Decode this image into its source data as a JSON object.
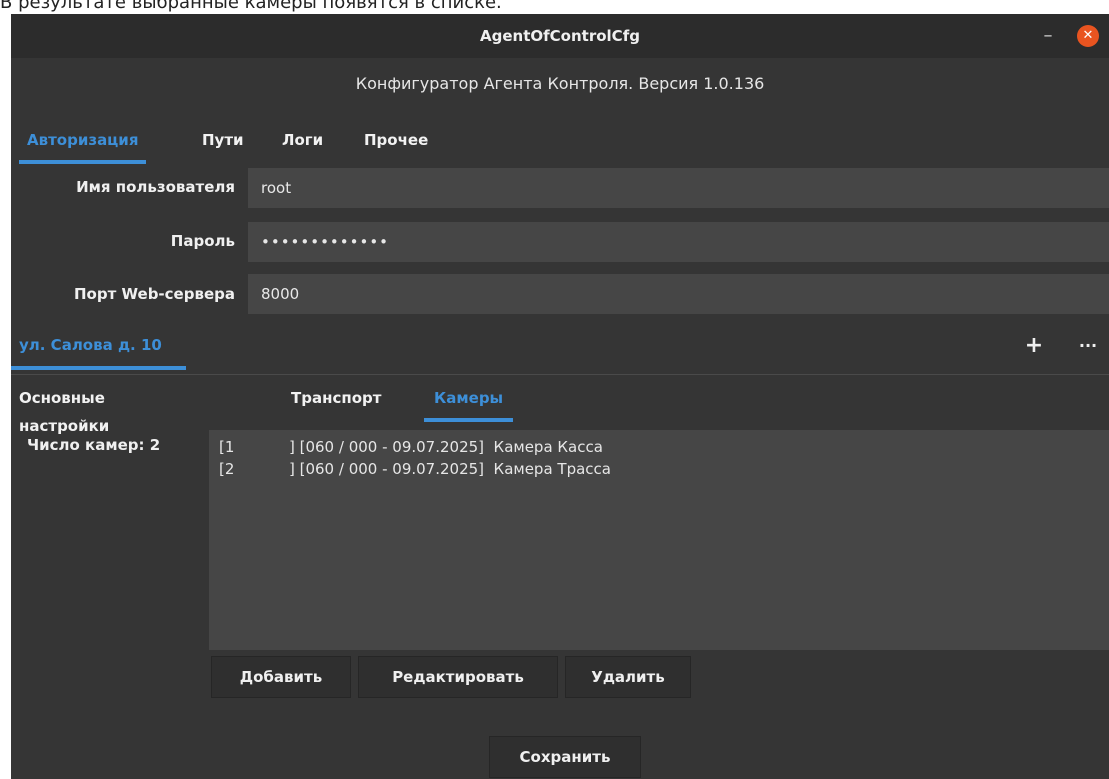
{
  "caption": "В результате выбранные камеры появятся в списке.",
  "window": {
    "title": "AgentOfControlCfg",
    "subtitle": "Конфигуратор Агента Контроля. Версия 1.0.136",
    "minimize_glyph": "–",
    "close_glyph": "✕"
  },
  "tabs": [
    {
      "label": "Авторизация",
      "active": true
    },
    {
      "label": "Пути",
      "active": false
    },
    {
      "label": "Логи",
      "active": false
    },
    {
      "label": "Прочее",
      "active": false
    }
  ],
  "auth": {
    "username_label": "Имя пользователя",
    "username_value": "root",
    "password_label": "Пароль",
    "password_value": "•••••••••••••",
    "port_label": "Порт Web-сервера",
    "port_value": "8000"
  },
  "site": {
    "name": "ул. Салова д. 10",
    "add_glyph": "+",
    "more_glyph": "···"
  },
  "subtabs": [
    {
      "label": "Основные настройки",
      "active": false
    },
    {
      "label": "Транспорт",
      "active": false
    },
    {
      "label": "Камеры",
      "active": true
    }
  ],
  "cameras": {
    "count_label": "Число камер: 2",
    "items": [
      {
        "index": "[1",
        "rest": "] [060 / 000 - 09.07.2025]  Камера Касса"
      },
      {
        "index": "[2",
        "rest": "] [060 / 000 - 09.07.2025]  Камера Трасса"
      }
    ]
  },
  "buttons": {
    "add": "Добавить",
    "edit": "Редактировать",
    "delete": "Удалить",
    "save": "Сохранить"
  },
  "colors": {
    "accent": "#3d8fd8",
    "window_bg": "#353535",
    "field_bg": "#464646",
    "close_button": "#e95420"
  }
}
